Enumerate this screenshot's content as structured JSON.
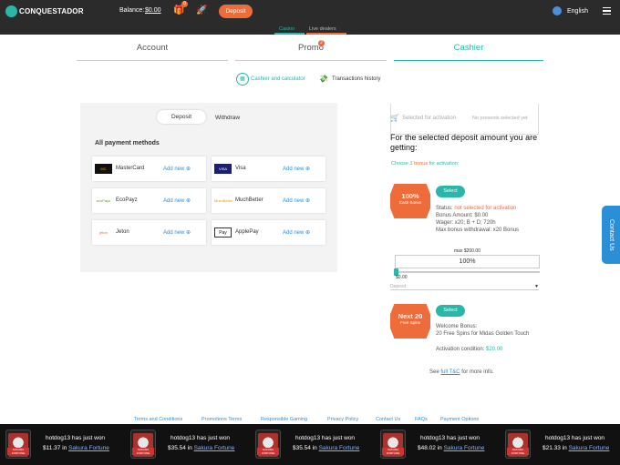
{
  "topbar": {
    "brand": "CONQUESTADOR",
    "balance_label": "Balance:",
    "balance_value": "$0.00",
    "gift_count": "0",
    "deposit_label": "Deposit",
    "language": "English"
  },
  "subnav": {
    "tabs": [
      {
        "label": "Casino"
      },
      {
        "label": "Live dealers"
      }
    ]
  },
  "tabs": [
    {
      "label": "Account"
    },
    {
      "label": "Promo"
    },
    {
      "label": "Cashier"
    }
  ],
  "promo_badge": "2",
  "links": {
    "cashier_calc": "Cashier and calculator",
    "history": "Transactions history"
  },
  "cashier": {
    "toggle": [
      "Deposit",
      "Withdraw"
    ],
    "all_methods": "All payment methods",
    "add_new": "Add new",
    "methods": [
      {
        "name": "MasterCard",
        "logo": "MC"
      },
      {
        "name": "Visa",
        "logo": "VISA"
      },
      {
        "name": "EcoPayz",
        "logo": "ecoPayz"
      },
      {
        "name": "MuchBetter",
        "logo": "MuchBetter"
      },
      {
        "name": "Jeton",
        "logo": "jeton"
      },
      {
        "name": "ApplePay",
        "logo": "Pay"
      }
    ]
  },
  "activation": {
    "selected": "Selected for activation",
    "none": "No presents selected yet",
    "heading": "For the selected deposit amount you are getting:",
    "choose_prefix": "Choose",
    "choose_count": "1",
    "choose_bonus": "bonus",
    "choose_suffix": "for activation:"
  },
  "bonus1": {
    "big": "100%",
    "small": "Cash Bonus",
    "select": "Select",
    "status_label": "Status:",
    "status_value": "not selected for activation",
    "amount": "Bonus Amount: $0.00",
    "wager": "Wager: x20; B + D; 720h",
    "max": "Max bonus withdrawal: x20 Bonus"
  },
  "slider": {
    "max": "max $200.00",
    "value": "100%",
    "min": "$0.00",
    "deposit_label": "Deposit",
    "level": 0
  },
  "bonus2": {
    "big": "Next 20",
    "small": "Free Spins",
    "select": "Select",
    "title": "Welcome Bonus:",
    "desc": "20 Free Spins for Midas Golden Touch",
    "cond_label": "Activation condition:",
    "cond_value": "$20.00"
  },
  "see": {
    "prefix": "See",
    "link": "full T&C",
    "suffix": "for more info."
  },
  "contact": "Contact Us",
  "footer": [
    "Terms and Conditions",
    "Promotions Terms",
    "Responsible Gaming",
    "Privacy Policy",
    "Contact Us",
    "FAQs",
    "Payment Options"
  ],
  "ticker": {
    "game_img_label": "SAKURA FORTUNE",
    "wins": [
      {
        "user": "hotdog13 has just won",
        "amount": "$11.37",
        "in": "in",
        "game": "Sakura Fortune"
      },
      {
        "user": "hotdog13 has just won",
        "amount": "$35.54",
        "in": "in",
        "game": "Sakura Fortune"
      },
      {
        "user": "hotdog13 has just won",
        "amount": "$35.54",
        "in": "in",
        "game": "Sakura Fortune"
      },
      {
        "user": "hotdog13 has just won",
        "amount": "$48.02",
        "in": "in",
        "game": "Sakura Fortune"
      },
      {
        "user": "hotdog13 has just won",
        "amount": "$21.33",
        "in": "in",
        "game": "Sakura Fortune"
      }
    ]
  },
  "colors": {
    "accent": "#2ab7a9",
    "orange": "#ee6b3a",
    "link": "#2b8fd8"
  }
}
